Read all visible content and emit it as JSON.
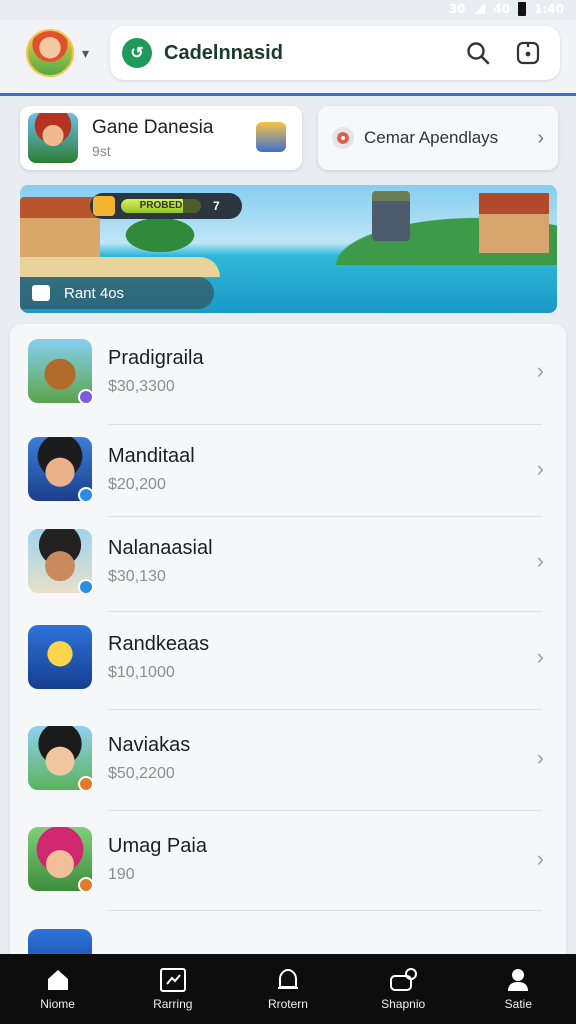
{
  "status_bar": {
    "left_text": "30",
    "right_text": "40",
    "time": "1:40"
  },
  "header": {
    "brand": "Cadelnnasid",
    "icons": [
      "search-icon",
      "notification-square-icon"
    ]
  },
  "featured": {
    "left_card": {
      "title": "Gane Danesia",
      "subtitle": "9st"
    },
    "right_card": {
      "title": "Cemar Apendlays"
    }
  },
  "banner": {
    "progress_text": "PROBED",
    "progress_number": "7",
    "progress_fraction": 0.78,
    "chip_text": "Rant 4os"
  },
  "items": [
    {
      "name": "Pradigraila",
      "price": "$30,3300",
      "badge_color": "#7b5ce0"
    },
    {
      "name": "Manditaal",
      "price": "$20,200",
      "badge_color": "#2d8be0"
    },
    {
      "name": "Nalanaasial",
      "price": "$30,130",
      "badge_color": "#2d8be0"
    },
    {
      "name": "Randkeaas",
      "price": "$10,1000",
      "badge_color": ""
    },
    {
      "name": "Naviakas",
      "price": "$50,2200",
      "badge_color": "#e07a2d"
    },
    {
      "name": "Umag Paia",
      "price": "190",
      "badge_color": "#e07a2d"
    }
  ],
  "nav": [
    {
      "label": "Niome",
      "icon": "home-icon"
    },
    {
      "label": "Rarring",
      "icon": "ranking-icon"
    },
    {
      "label": "Rrotern",
      "icon": "bell-icon"
    },
    {
      "label": "Shapnio",
      "icon": "shop-icon"
    },
    {
      "label": "Satie",
      "icon": "profile-icon"
    }
  ],
  "colors": {
    "accent": "#2f6fd6",
    "brand_green": "#1e9b5a",
    "nav_bg": "#0d0d0d"
  }
}
